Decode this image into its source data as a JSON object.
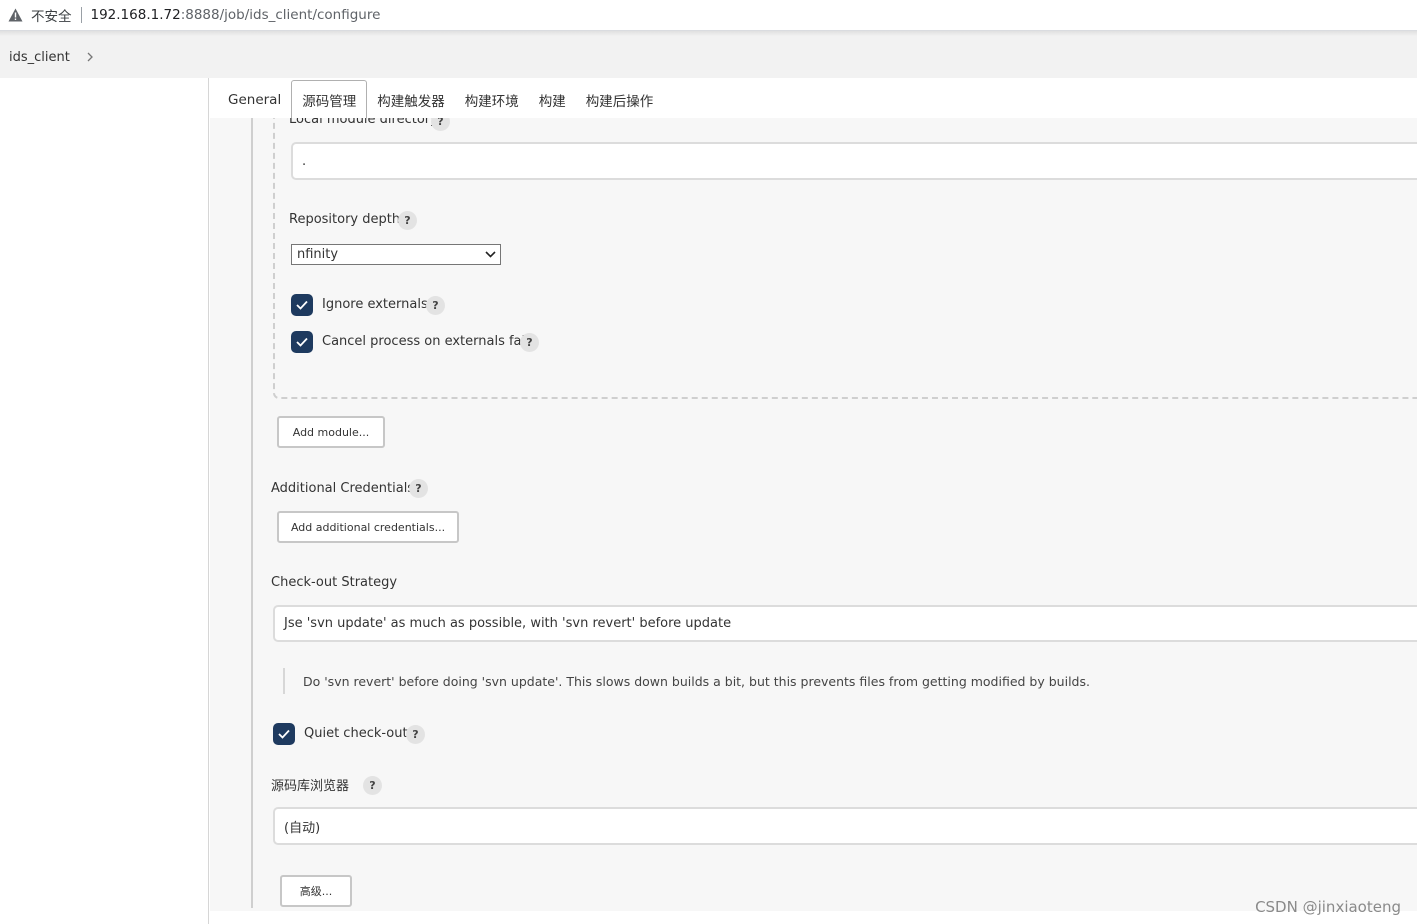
{
  "browser": {
    "security_label": "不安全",
    "url_host": "192.168.1.72",
    "url_path": ":8888/job/ids_client/configure"
  },
  "breadcrumb": {
    "item": "ids_client"
  },
  "tabs": [
    "General",
    "源码管理",
    "构建触发器",
    "构建环境",
    "构建",
    "构建后操作"
  ],
  "active_tab": "源码管理",
  "form": {
    "local_module_label": "Local module directory",
    "local_module_value": ".",
    "repo_depth_label": "Repository depth",
    "repo_depth_value": "nfinity",
    "ignore_externals_label": "Ignore externals",
    "ignore_externals_checked": true,
    "cancel_externals_label": "Cancel process on externals fail",
    "cancel_externals_checked": true,
    "add_module_button": "Add module...",
    "additional_credentials_label": "Additional Credentials",
    "add_credentials_button": "Add additional credentials...",
    "checkout_strategy_label": "Check-out Strategy",
    "checkout_strategy_value": "Jse 'svn update' as much as possible, with 'svn revert' before update",
    "checkout_strategy_desc": "Do 'svn revert' before doing 'svn update'. This slows down builds a bit, but this prevents files from getting modified by builds.",
    "quiet_checkout_label": "Quiet check-out",
    "quiet_checkout_checked": true,
    "repo_browser_label": "源码库浏览器",
    "repo_browser_value": "(自动)",
    "advanced_button": "高级...",
    "help_symbol": "?"
  },
  "watermark": "CSDN @jinxiaoteng",
  "colors": {
    "checkbox": "#1e3a5f",
    "page_bg": "#f7f7f7"
  }
}
